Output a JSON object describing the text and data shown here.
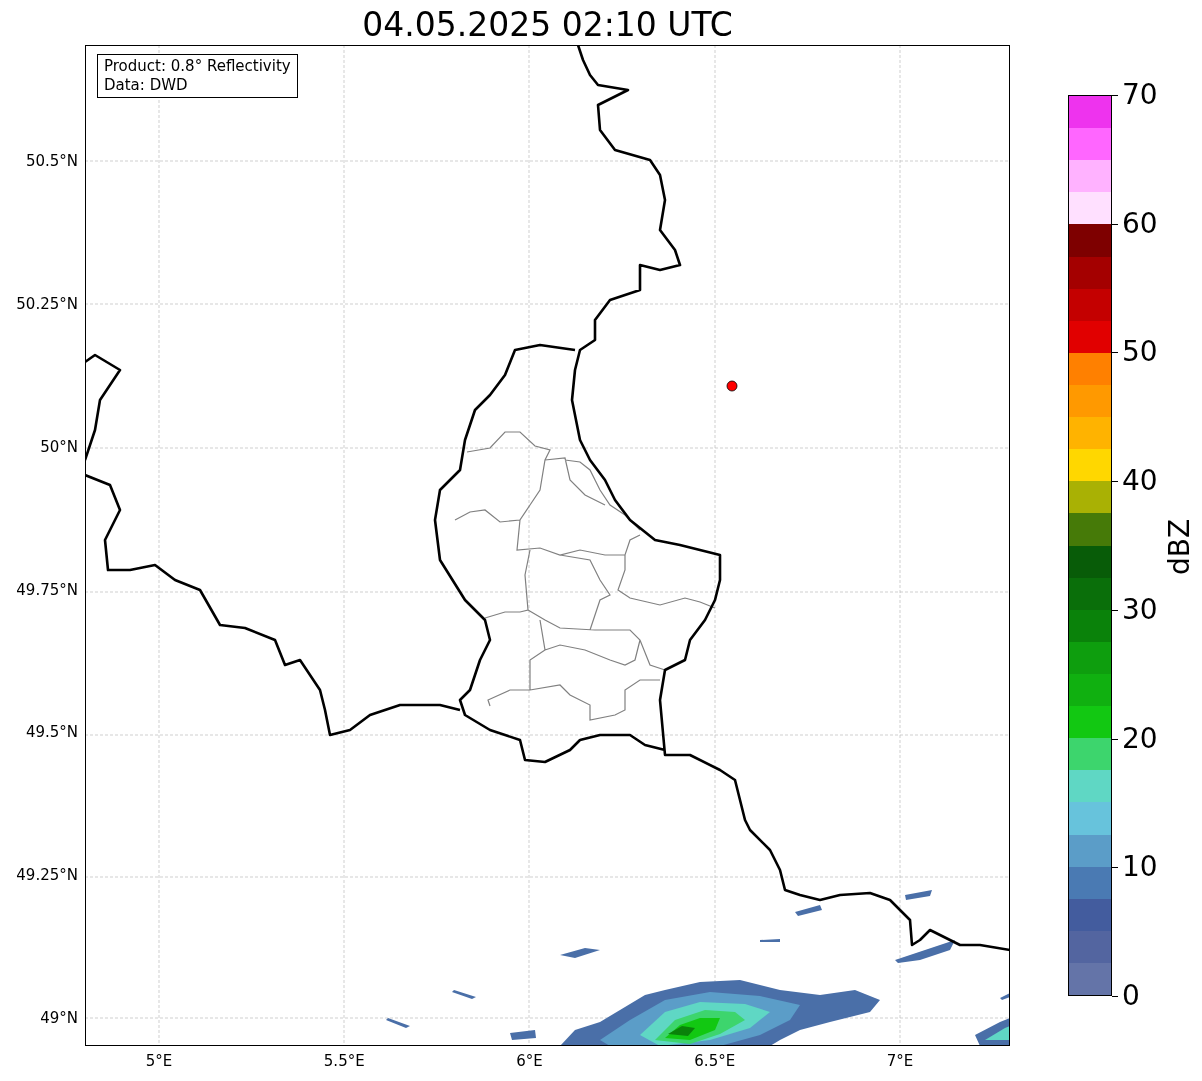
{
  "title": "04.05.2025 02:10 UTC",
  "info_box": [
    "Product: 0.8° Reflectivity",
    "Data: DWD"
  ],
  "y_ticks": [
    "50.5°N",
    "50.25°N",
    "50°N",
    "49.75°N",
    "49.5°N",
    "49.25°N",
    "49°N"
  ],
  "x_ticks": [
    "5°E",
    "5.5°E",
    "6°E",
    "6.5°E",
    "7°E"
  ],
  "colorbar": {
    "label": "dBZ",
    "ticks": [
      "70",
      "60",
      "50",
      "40",
      "30",
      "20",
      "10",
      "0"
    ],
    "segments": [
      {
        "color": "#ee33ee"
      },
      {
        "color": "#ff66ff"
      },
      {
        "color": "#ffb2ff"
      },
      {
        "color": "#ffe0ff"
      },
      {
        "color": "#7e0000"
      },
      {
        "color": "#a40000"
      },
      {
        "color": "#c40000"
      },
      {
        "color": "#e10000"
      },
      {
        "color": "#ff8000"
      },
      {
        "color": "#ff9900"
      },
      {
        "color": "#ffb300"
      },
      {
        "color": "#ffd700"
      },
      {
        "color": "#a9b104"
      },
      {
        "color": "#467a08"
      },
      {
        "color": "#085c08"
      },
      {
        "color": "#0a6f0a"
      },
      {
        "color": "#0a820a"
      },
      {
        "color": "#0e9e0e"
      },
      {
        "color": "#10b010"
      },
      {
        "color": "#12c812"
      },
      {
        "color": "#3dd56d"
      },
      {
        "color": "#5fd7c4"
      },
      {
        "color": "#67c3dc"
      },
      {
        "color": "#5b9dc8"
      },
      {
        "color": "#4a7ab3"
      },
      {
        "color": "#435c9e"
      },
      {
        "color": "#5365a0"
      },
      {
        "color": "#6474a8"
      }
    ]
  }
}
